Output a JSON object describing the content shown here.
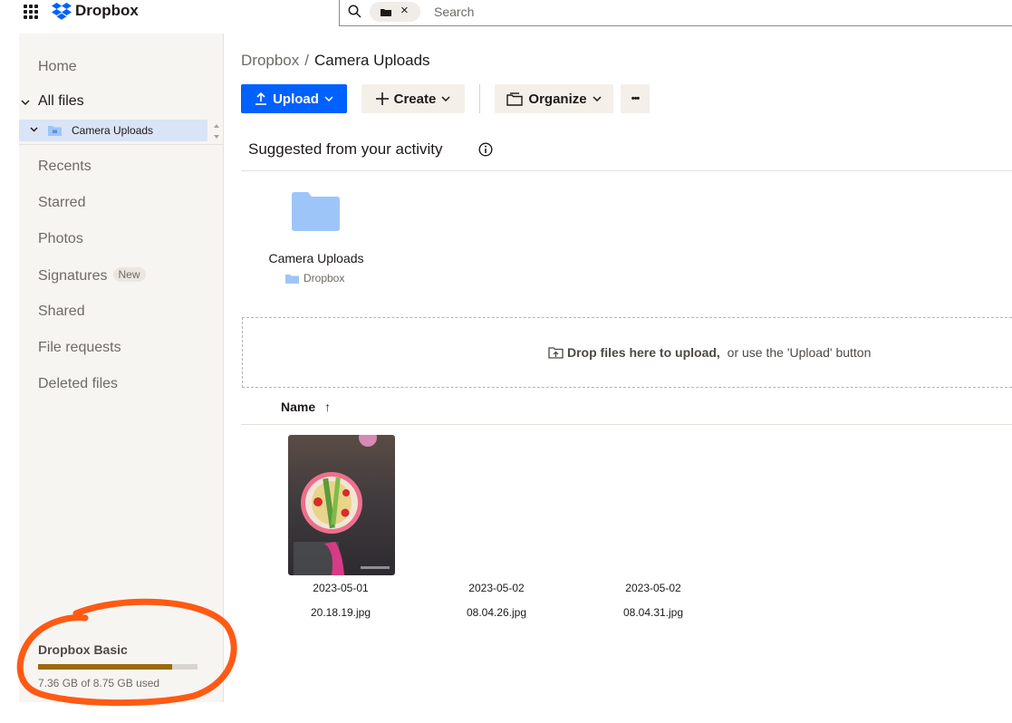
{
  "app": {
    "brand": "Dropbox"
  },
  "search": {
    "placeholder": "Search",
    "chip_icon": "folder-icon",
    "chip_close": "×"
  },
  "sidebar": {
    "items": {
      "home": "Home",
      "all_files": "All files",
      "recents": "Recents",
      "starred": "Starred",
      "photos": "Photos",
      "signatures": "Signatures",
      "signatures_badge": "New",
      "shared": "Shared",
      "file_requests": "File requests",
      "deleted_files": "Deleted files"
    },
    "tree": {
      "folder": "Camera Uploads"
    },
    "plan": {
      "title": "Dropbox Basic",
      "usage_text": "7.36 GB of 8.75 GB used",
      "used_gb": 7.36,
      "total_gb": 8.75
    }
  },
  "main": {
    "breadcrumb": {
      "root": "Dropbox",
      "separator": "/",
      "current": "Camera Uploads"
    },
    "toolbar": {
      "upload": "Upload",
      "create": "Create",
      "organize": "Organize",
      "more": "•••"
    },
    "suggested": {
      "title": "Suggested from your activity",
      "item_name": "Camera Uploads",
      "item_location": "Dropbox"
    },
    "dropzone": {
      "bold": "Drop files here to upload,",
      "rest": " or use the 'Upload' button"
    },
    "list_header": {
      "name": "Name",
      "sort_arrow": "↑"
    },
    "files": [
      {
        "date": "2023-05-01",
        "time": "20.18.19.jpg"
      },
      {
        "date": "2023-05-02",
        "time": "08.04.26.jpg"
      },
      {
        "date": "2023-05-02",
        "time": "08.04.31.jpg"
      }
    ]
  },
  "colors": {
    "accent": "#0061fe",
    "sidebar_bg": "#f7f5f2",
    "usage_fill": "#9b6a0b",
    "annotation": "#ff5a14",
    "folder": "#9ec5f8"
  }
}
